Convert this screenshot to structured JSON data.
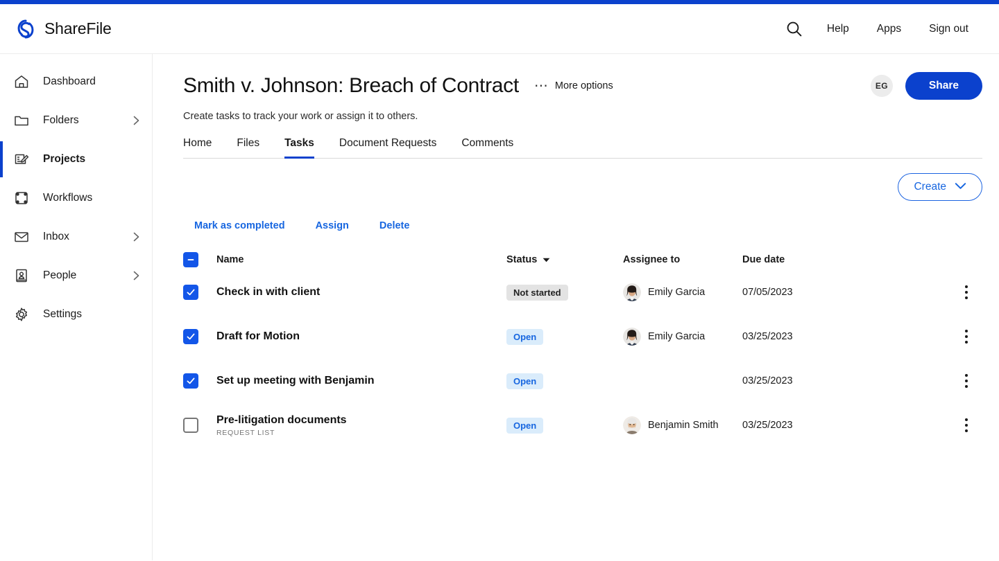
{
  "brand": {
    "name": "ShareFile",
    "logo_icon": "sharefile-logo-icon",
    "accent": "#0b41cd"
  },
  "header": {
    "search_icon": "search-icon",
    "links": [
      {
        "label": "Help",
        "name": "help-link"
      },
      {
        "label": "Apps",
        "name": "apps-link"
      },
      {
        "label": "Sign out",
        "name": "sign-out-link"
      }
    ]
  },
  "sidebar": {
    "items": [
      {
        "label": "Dashboard",
        "icon": "home-icon",
        "active": false,
        "chevron": false
      },
      {
        "label": "Folders",
        "icon": "folder-icon",
        "active": false,
        "chevron": true
      },
      {
        "label": "Projects",
        "icon": "project-clipboard-pencil-icon",
        "active": true,
        "chevron": false
      },
      {
        "label": "Workflows",
        "icon": "workflow-nodes-icon",
        "active": false,
        "chevron": false
      },
      {
        "label": "Inbox",
        "icon": "envelope-icon",
        "active": false,
        "chevron": true
      },
      {
        "label": "People",
        "icon": "person-card-icon",
        "active": false,
        "chevron": true
      },
      {
        "label": "Settings",
        "icon": "gear-icon",
        "active": false,
        "chevron": false
      }
    ]
  },
  "page": {
    "title": "Smith v. Johnson: Breach of Contract",
    "more_options_label": "More options",
    "more_options_icon": "ellipsis-horizontal-icon",
    "subtitle": "Create tasks to track your work or assign it to others.",
    "avatar_initials": "EG",
    "share_label": "Share"
  },
  "tabs": [
    {
      "label": "Home",
      "active": false
    },
    {
      "label": "Files",
      "active": false
    },
    {
      "label": "Tasks",
      "active": true
    },
    {
      "label": "Document Requests",
      "active": false
    },
    {
      "label": "Comments",
      "active": false
    }
  ],
  "toolbar": {
    "create_label": "Create",
    "create_chevron_icon": "chevron-down-icon"
  },
  "bulk_actions": [
    {
      "label": "Mark as completed",
      "name": "mark-as-completed-action"
    },
    {
      "label": "Assign",
      "name": "assign-action"
    },
    {
      "label": "Delete",
      "name": "delete-action"
    }
  ],
  "table": {
    "select_all_state": "indeterminate",
    "columns": {
      "name": "Name",
      "status": "Status",
      "status_sort_icon": "sort-caret-down-icon",
      "assignee": "Assignee to",
      "due_date": "Due date"
    },
    "rows": [
      {
        "checked": true,
        "name": "Check in with client",
        "subtitle": "",
        "status": "Not started",
        "status_style": "gray",
        "assignee": "Emily Garcia",
        "assignee_avatar": "emily-garcia-avatar",
        "due_date": "07/05/2023",
        "menu_icon": "kebab-menu-icon"
      },
      {
        "checked": true,
        "name": "Draft for Motion",
        "subtitle": "",
        "status": "Open",
        "status_style": "blue",
        "assignee": "Emily Garcia",
        "assignee_avatar": "emily-garcia-avatar",
        "due_date": "03/25/2023",
        "menu_icon": "kebab-menu-icon"
      },
      {
        "checked": true,
        "name": "Set up meeting with Benjamin",
        "subtitle": "",
        "status": "Open",
        "status_style": "blue",
        "assignee": "",
        "assignee_avatar": "",
        "due_date": "03/25/2023",
        "menu_icon": "kebab-menu-icon"
      },
      {
        "checked": false,
        "name": "Pre-litigation documents",
        "subtitle": "REQUEST LIST",
        "status": "Open",
        "status_style": "blue",
        "assignee": "Benjamin Smith",
        "assignee_avatar": "benjamin-smith-avatar",
        "due_date": "03/25/2023",
        "menu_icon": "kebab-menu-icon"
      }
    ]
  },
  "colors": {
    "brand_blue": "#0b41cd",
    "link_blue": "#1766e0",
    "badge_gray_bg": "#e3e3e3",
    "badge_blue_bg": "#daecfb"
  }
}
